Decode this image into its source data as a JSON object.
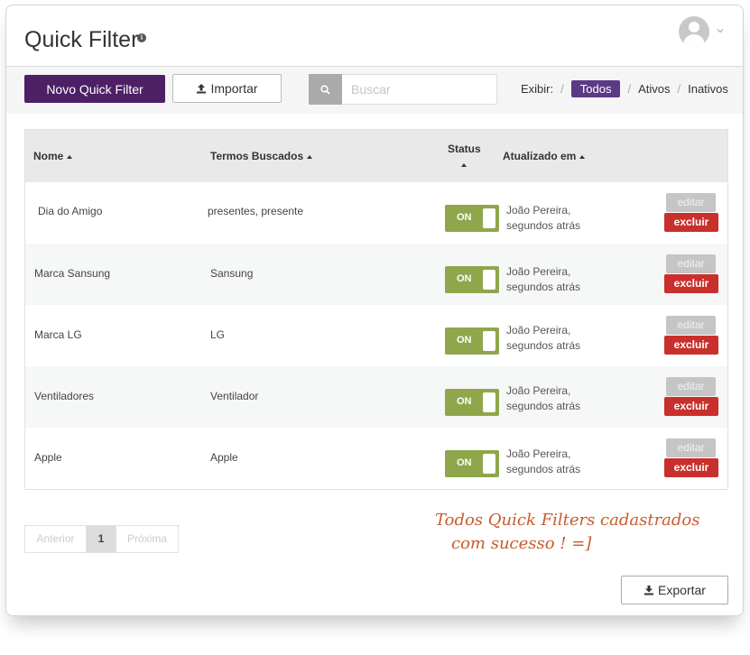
{
  "header": {
    "title": "Quick Filter",
    "info_glyph": "i"
  },
  "toolbar": {
    "new_label": "Novo Quick Filter",
    "import_label": "Importar",
    "search_placeholder": "Buscar",
    "filter_label": "Exibir:",
    "filters": [
      "Todos",
      "Ativos",
      "Inativos"
    ],
    "active_filter": "Todos"
  },
  "table": {
    "columns": {
      "name": "Nome",
      "terms": "Termos Buscados",
      "status": "Status",
      "updated": "Atualizado em"
    },
    "rows": [
      {
        "name": "Dia do Amigo",
        "terms": "presentes, presente",
        "status": "ON",
        "updated_by": "João Pereira,",
        "updated_when": "segundos atrás"
      },
      {
        "name": "Marca Sansung",
        "terms": "Sansung",
        "status": "ON",
        "updated_by": "João Pereira,",
        "updated_when": "segundos atrás"
      },
      {
        "name": "Marca LG",
        "terms": "LG",
        "status": "ON",
        "updated_by": "João Pereira,",
        "updated_when": "segundos atrás"
      },
      {
        "name": "Ventiladores",
        "terms": "Ventilador",
        "status": "ON",
        "updated_by": "João Pereira,",
        "updated_when": "segundos atrás"
      },
      {
        "name": "Apple",
        "terms": "Apple",
        "status": "ON",
        "updated_by": "João Pereira,",
        "updated_when": "segundos atrás"
      }
    ],
    "edit_label": "editar",
    "delete_label": "excluir"
  },
  "pagination": {
    "prev": "Anterior",
    "current": "1",
    "next": "Próxima"
  },
  "annotation": {
    "line1": "Todos Quick Filters cadastrados",
    "line2": "com sucesso !  =]"
  },
  "export_label": "Exportar",
  "colors": {
    "primary": "#4d2066",
    "active_filter": "#5c3a86",
    "toggle_on": "#8fa64b",
    "delete": "#c9302c",
    "annotation": "#c95b2c"
  }
}
